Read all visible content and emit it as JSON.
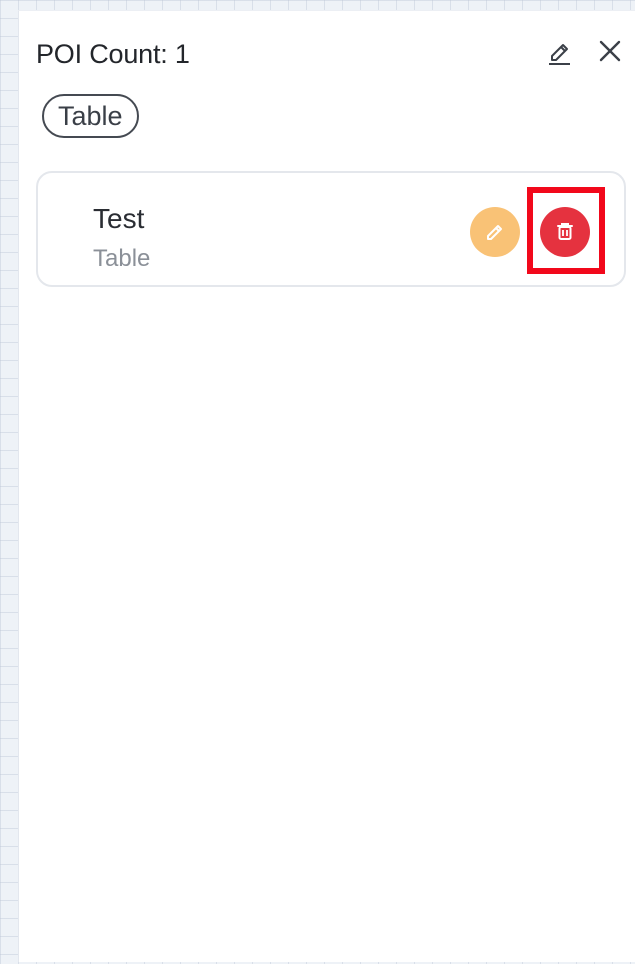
{
  "panel": {
    "title": "POI Count: 1",
    "edit_icon": "pencil-underline-icon",
    "close_icon": "close-icon"
  },
  "filter_chip": {
    "label": "Table"
  },
  "poi_list": [
    {
      "name": "Test",
      "type": "Table",
      "edit_icon": "pencil-icon",
      "delete_icon": "trash-icon"
    }
  ],
  "colors": {
    "edit_button": "#f9c276",
    "delete_button": "#e5323f",
    "highlight": "#f2081b",
    "text_primary": "#23262b",
    "text_secondary": "#8b9098"
  }
}
